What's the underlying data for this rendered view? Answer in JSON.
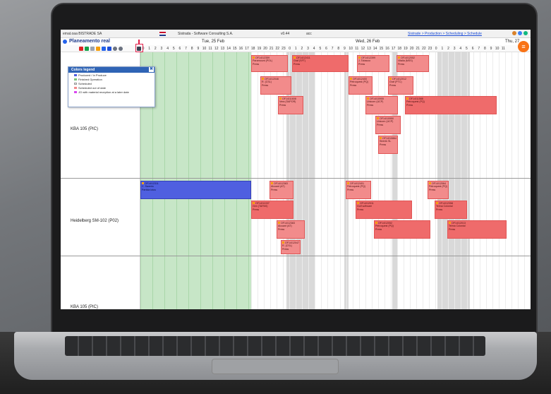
{
  "topbar": {
    "company": "emat.oaa BISTRADE SA",
    "tenant": "Sistrada - Software Consulting S.A.",
    "version": "v0.44",
    "user": "acc",
    "breadcrumb": "Sistrade > Production > Scheduling > Schedule"
  },
  "header": {
    "title": "Planeamento real",
    "days": [
      "Tue, 25 Feb",
      "Wed, 26 Feb",
      "Thu, 27"
    ]
  },
  "toolbar": {
    "hours": [
      "0",
      "1",
      "2",
      "3",
      "4",
      "5",
      "6",
      "7",
      "8",
      "9",
      "10",
      "11",
      "12",
      "13",
      "14",
      "15",
      "16",
      "17",
      "18",
      "19",
      "20",
      "21",
      "22",
      "23",
      "0",
      "1",
      "2",
      "3",
      "4",
      "5",
      "6",
      "7",
      "8",
      "9",
      "10",
      "11",
      "12",
      "13",
      "14",
      "15",
      "16",
      "17",
      "18",
      "19",
      "20",
      "21",
      "22",
      "23",
      "0",
      "1",
      "2",
      "3",
      "4",
      "5",
      "6",
      "7",
      "8",
      "9",
      "10",
      "11"
    ]
  },
  "legend": {
    "title": "Colors legend",
    "close": "✖",
    "items": [
      {
        "label": "Produced / In Produce",
        "color": "#4f5fe0"
      },
      {
        "label": "Finished Operation",
        "color": "#7bc67b"
      },
      {
        "label": "Scheduled",
        "color": "#e5e5e5"
      },
      {
        "label": "Scheduled out of date",
        "color": "#f28b8b"
      },
      {
        "label": "JO with material reception at a later date",
        "color": "#d946ef"
      }
    ]
  },
  "machines": [
    "KBA 105 (PIC)",
    "Heidelberg SM-102 (P02)",
    "KBA 105 (PIC)"
  ],
  "tasks": [
    {
      "l1": "OF14/12359",
      "l2": "Paramount (POL)",
      "l3": "Press"
    },
    {
      "l1": "OF14/12411",
      "l2": "Graf (SFT)",
      "l3": "Press"
    },
    {
      "l1": "OF14/12399",
      "l2": "J. Tobacco",
      "l3": "Press"
    },
    {
      "l1": "OF14/12052",
      "l2": "Vitalia (MSS)",
      "l3": "Press"
    },
    {
      "l1": "OF14/12046",
      "l2": "R. (CSL)",
      "l3": "Press"
    },
    {
      "l1": "OF14/12400",
      "l2": "Petroquest (PQ)",
      "l3": "Press"
    },
    {
      "l1": "OF14/12012",
      "l2": "Graf (PTC)",
      "l3": "Press"
    },
    {
      "l1": "OF14/11608",
      "l2": "Vera (SAPOR)",
      "l3": "Press"
    },
    {
      "l1": "OF14/10955",
      "l2": "Unicorn (UCP)",
      "l3": "Press"
    },
    {
      "l1": "OF14/11588",
      "l2": "Petroquest (PQ)",
      "l3": "Press"
    },
    {
      "l1": "OF14/10950",
      "l2": "Unicorn (UCP)",
      "l3": "Press"
    },
    {
      "l1": "OF14/10864",
      "l2": "Sirenik SL",
      "l3": "Press"
    },
    {
      "l1": "OF14/12311",
      "l2": "C. Saverio",
      "l3": "Partida lotus"
    },
    {
      "l1": "OF14/12383",
      "l2": "Alcuant (AT)",
      "l3": "Press"
    },
    {
      "l1": "OF14/12401",
      "l2": "Petroquest (PQ)",
      "l3": "Press"
    },
    {
      "l1": "OF14/12064",
      "l2": "Petroquest (PQ)",
      "l3": "Press"
    },
    {
      "l1": "OF14/11037",
      "l2": "Gen (TAPAS)",
      "l3": "Press"
    },
    {
      "l1": "OF14/12011",
      "l2": "Golf software",
      "l3": "Press"
    },
    {
      "l1": "OF14/12358",
      "l2": "Teima Colonial",
      "l3": "Press"
    },
    {
      "l1": "OF14/12383",
      "l2": "Alcuant (AT)",
      "l3": "Press"
    },
    {
      "l1": "OF14/12052",
      "l2": "Petroquest (PQ)",
      "l3": "Press"
    },
    {
      "l1": "OF14/12013",
      "l2": "Teima Colonial",
      "l3": "Press"
    },
    {
      "l1": "OF14/12047",
      "l2": "R. (CSL)",
      "l3": "Press"
    }
  ]
}
